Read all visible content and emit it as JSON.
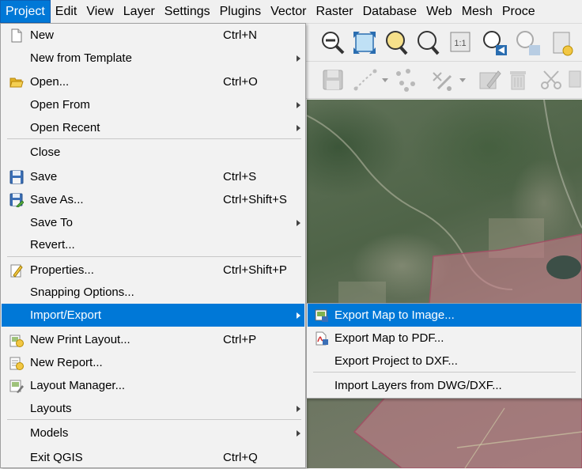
{
  "menubar": {
    "items": [
      "Project",
      "Edit",
      "View",
      "Layer",
      "Settings",
      "Plugins",
      "Vector",
      "Raster",
      "Database",
      "Web",
      "Mesh",
      "Proce"
    ]
  },
  "project_menu": {
    "items": [
      {
        "label": "New",
        "shortcut": "Ctrl+N",
        "icon": "new-document-icon"
      },
      {
        "label": "New from Template",
        "submenu": true
      },
      {
        "label": "Open...",
        "shortcut": "Ctrl+O",
        "icon": "folder-open-icon"
      },
      {
        "label": "Open From",
        "submenu": true
      },
      {
        "label": "Open Recent",
        "submenu": true
      },
      {
        "label": "Close"
      },
      {
        "label": "Save",
        "shortcut": "Ctrl+S",
        "icon": "save-icon"
      },
      {
        "label": "Save As...",
        "shortcut": "Ctrl+Shift+S",
        "icon": "save-as-icon"
      },
      {
        "label": "Save To",
        "submenu": true
      },
      {
        "label": "Revert..."
      },
      {
        "label": "Properties...",
        "shortcut": "Ctrl+Shift+P",
        "icon": "properties-icon"
      },
      {
        "label": "Snapping Options..."
      },
      {
        "label": "Import/Export",
        "submenu": true,
        "highlighted": true
      },
      {
        "label": "New Print Layout...",
        "shortcut": "Ctrl+P",
        "icon": "print-layout-icon"
      },
      {
        "label": "New Report...",
        "icon": "report-icon"
      },
      {
        "label": "Layout Manager...",
        "icon": "layout-manager-icon"
      },
      {
        "label": "Layouts",
        "submenu": true
      },
      {
        "label": "Models",
        "submenu": true
      },
      {
        "label": "Exit QGIS",
        "shortcut": "Ctrl+Q"
      }
    ]
  },
  "import_export_submenu": {
    "items": [
      {
        "label": "Export Map to Image...",
        "icon": "export-image-icon",
        "highlighted": true
      },
      {
        "label": "Export Map to PDF...",
        "icon": "pdf-icon"
      },
      {
        "label": "Export Project to DXF..."
      },
      {
        "label": "Import Layers from DWG/DXF..."
      }
    ]
  },
  "colors": {
    "highlight": "#0078d7",
    "menu_bg": "#f2f2f2",
    "polygon_fill": "#c97a8a"
  }
}
